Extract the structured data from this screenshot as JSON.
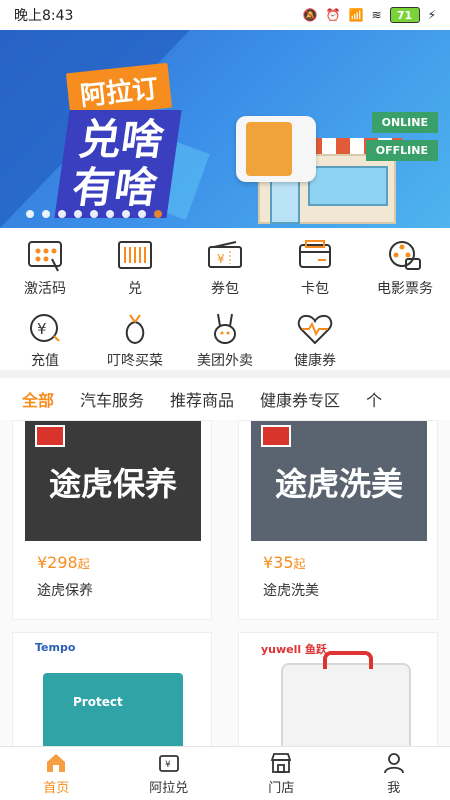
{
  "status_bar": {
    "time": "晚上8:43",
    "battery": "71"
  },
  "banner": {
    "tag": "阿拉订",
    "headline_line1": "兑啥",
    "headline_line2": "有啥",
    "sign_online": "ONLINE",
    "sign_offline": "OFFLINE"
  },
  "quick_grid": [
    {
      "label": "激活码",
      "icon": "activation-code-icon"
    },
    {
      "label": "兑",
      "icon": "barcode-icon"
    },
    {
      "label": "券包",
      "icon": "coupon-icon"
    },
    {
      "label": "卡包",
      "icon": "wallet-icon"
    },
    {
      "label": "电影票务",
      "icon": "movie-reel-icon"
    },
    {
      "label": "充值",
      "icon": "recharge-icon"
    },
    {
      "label": "叮咚买菜",
      "icon": "vegetable-icon"
    },
    {
      "label": "美团外卖",
      "icon": "rabbit-icon"
    },
    {
      "label": "健康券",
      "icon": "heart-pulse-icon"
    }
  ],
  "tabs": [
    "全部",
    "汽车服务",
    "推荐商品",
    "健康券专区",
    "个"
  ],
  "products": [
    {
      "title": "途虎保养",
      "price": "¥298",
      "price_suffix": "起",
      "name": "途虎保养"
    },
    {
      "title": "途虎洗美",
      "price": "¥35",
      "price_suffix": "起",
      "name": "途虎洗美"
    },
    {
      "brand": "Tempo",
      "pkg_label": "Protect"
    },
    {
      "brand": "yuwell 鱼跃"
    }
  ],
  "tabbar": [
    {
      "label": "首页",
      "icon": "home-icon"
    },
    {
      "label": "阿拉兑",
      "icon": "voucher-icon"
    },
    {
      "label": "门店",
      "icon": "store-icon"
    },
    {
      "label": "我",
      "icon": "user-icon"
    }
  ],
  "colors": {
    "accent": "#f68d1e",
    "banner_blue": "#2f6fd1"
  }
}
